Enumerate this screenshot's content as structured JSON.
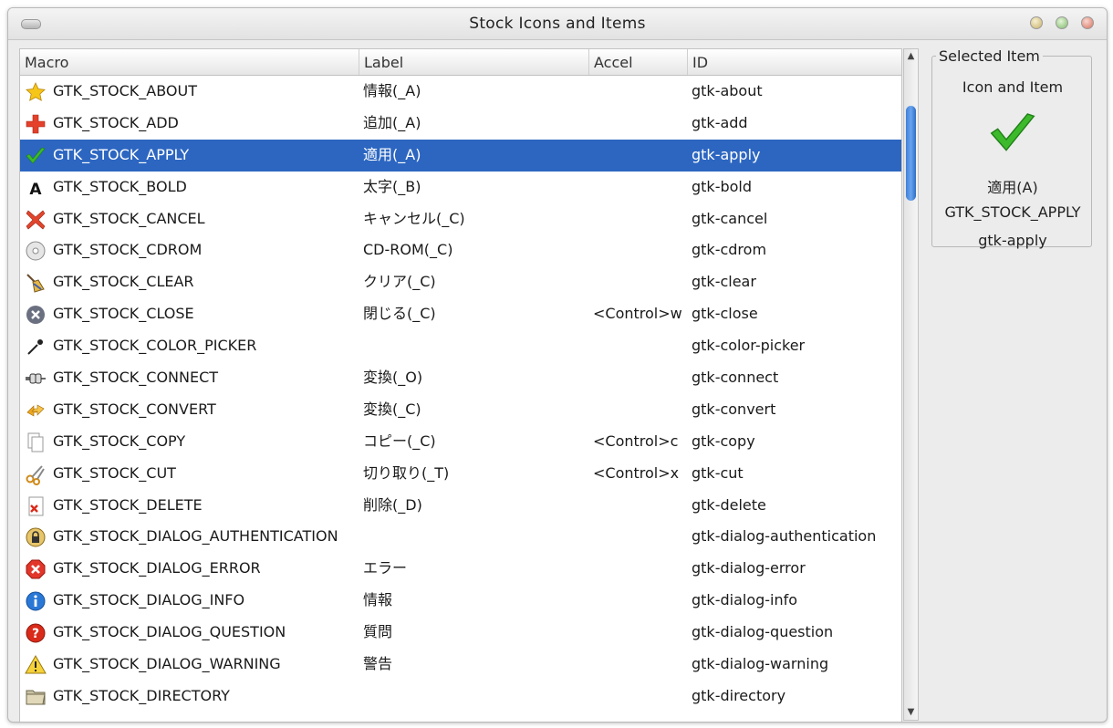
{
  "window": {
    "title": "Stock Icons and Items",
    "accent": "#2c66c1"
  },
  "columns": {
    "macro": "Macro",
    "label": "Label",
    "accel": "Accel",
    "id": "ID"
  },
  "rows": [
    {
      "icon": "star-icon",
      "macro": "GTK_STOCK_ABOUT",
      "label": "情報(_A)",
      "accel": "",
      "id": "gtk-about"
    },
    {
      "icon": "plus-icon",
      "macro": "GTK_STOCK_ADD",
      "label": "追加(_A)",
      "accel": "",
      "id": "gtk-add"
    },
    {
      "icon": "checkmark-icon",
      "macro": "GTK_STOCK_APPLY",
      "label": "適用(_A)",
      "accel": "",
      "id": "gtk-apply"
    },
    {
      "icon": "bold-icon",
      "macro": "GTK_STOCK_BOLD",
      "label": "太字(_B)",
      "accel": "",
      "id": "gtk-bold"
    },
    {
      "icon": "cancel-x-icon",
      "macro": "GTK_STOCK_CANCEL",
      "label": "キャンセル(_C)",
      "accel": "",
      "id": "gtk-cancel"
    },
    {
      "icon": "cdrom-icon",
      "macro": "GTK_STOCK_CDROM",
      "label": "CD-ROM(_C)",
      "accel": "",
      "id": "gtk-cdrom"
    },
    {
      "icon": "broom-icon",
      "macro": "GTK_STOCK_CLEAR",
      "label": "クリア(_C)",
      "accel": "",
      "id": "gtk-clear"
    },
    {
      "icon": "close-circle-icon",
      "macro": "GTK_STOCK_CLOSE",
      "label": "閉じる(_C)",
      "accel": "<Control>w",
      "id": "gtk-close"
    },
    {
      "icon": "eyedropper-icon",
      "macro": "GTK_STOCK_COLOR_PICKER",
      "label": "",
      "accel": "",
      "id": "gtk-color-picker"
    },
    {
      "icon": "plug-icon",
      "macro": "GTK_STOCK_CONNECT",
      "label": "変換(_O)",
      "accel": "",
      "id": "gtk-connect"
    },
    {
      "icon": "convert-arrows-icon",
      "macro": "GTK_STOCK_CONVERT",
      "label": "変換(_C)",
      "accel": "",
      "id": "gtk-convert"
    },
    {
      "icon": "copy-icon",
      "macro": "GTK_STOCK_COPY",
      "label": "コピー(_C)",
      "accel": "<Control>c",
      "id": "gtk-copy"
    },
    {
      "icon": "scissors-icon",
      "macro": "GTK_STOCK_CUT",
      "label": "切り取り(_T)",
      "accel": "<Control>x",
      "id": "gtk-cut"
    },
    {
      "icon": "delete-document-icon",
      "macro": "GTK_STOCK_DELETE",
      "label": "削除(_D)",
      "accel": "",
      "id": "gtk-delete"
    },
    {
      "icon": "lock-icon",
      "macro": "GTK_STOCK_DIALOG_AUTHENTICATION",
      "label": "",
      "accel": "",
      "id": "gtk-dialog-authentication"
    },
    {
      "icon": "error-icon",
      "macro": "GTK_STOCK_DIALOG_ERROR",
      "label": "エラー",
      "accel": "",
      "id": "gtk-dialog-error"
    },
    {
      "icon": "info-icon",
      "macro": "GTK_STOCK_DIALOG_INFO",
      "label": "情報",
      "accel": "",
      "id": "gtk-dialog-info"
    },
    {
      "icon": "question-icon",
      "macro": "GTK_STOCK_DIALOG_QUESTION",
      "label": "質問",
      "accel": "",
      "id": "gtk-dialog-question"
    },
    {
      "icon": "warning-icon",
      "macro": "GTK_STOCK_DIALOG_WARNING",
      "label": "警告",
      "accel": "",
      "id": "gtk-dialog-warning"
    },
    {
      "icon": "folder-icon",
      "macro": "GTK_STOCK_DIRECTORY",
      "label": "",
      "accel": "",
      "id": "gtk-directory"
    }
  ],
  "selected_index": 2,
  "selected": {
    "frame_title": "Selected Item",
    "subtitle": "Icon and Item",
    "icon": "checkmark-icon",
    "label": "適用(A)",
    "macro": "GTK_STOCK_APPLY",
    "id": "gtk-apply"
  }
}
